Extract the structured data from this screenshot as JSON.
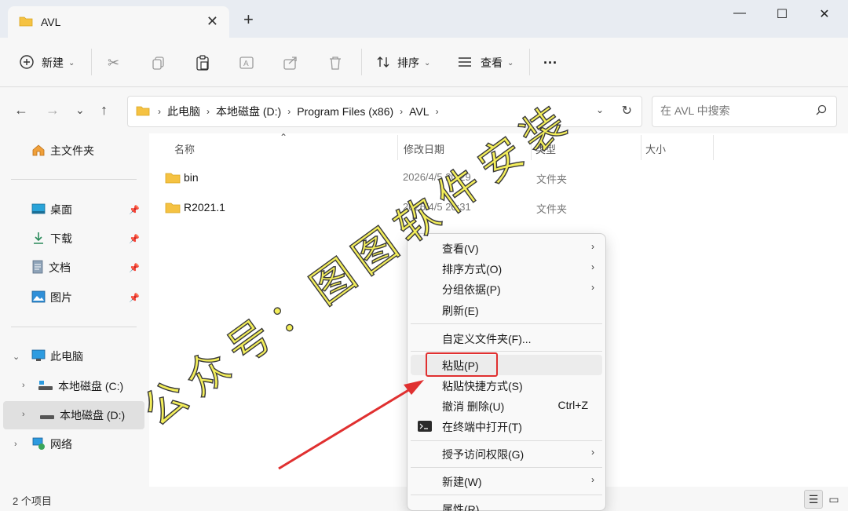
{
  "window": {
    "tab_title": "AVL",
    "tab_close": "✕",
    "new_tab": "+",
    "minimize": "—",
    "maximize": "☐",
    "close": "✕"
  },
  "toolbar": {
    "new_label": "新建",
    "sort_label": "排序",
    "view_label": "查看",
    "more_label": "···"
  },
  "address": {
    "crumbs": [
      "此电脑",
      "本地磁盘 (D:)",
      "Program Files (x86)",
      "AVL"
    ],
    "search_placeholder": "在 AVL 中搜索"
  },
  "sidebar": {
    "home": "主文件夹",
    "quick": [
      {
        "label": "桌面",
        "icon": "desktop-icon"
      },
      {
        "label": "下载",
        "icon": "download-icon"
      },
      {
        "label": "文档",
        "icon": "document-icon"
      },
      {
        "label": "图片",
        "icon": "pictures-icon"
      }
    ],
    "this_pc": "此电脑",
    "drives": [
      "本地磁盘 (C:)",
      "本地磁盘 (D:)"
    ],
    "network": "网络"
  },
  "columns": {
    "name": "名称",
    "date": "修改日期",
    "type": "类型",
    "size": "大小"
  },
  "files": [
    {
      "name": "bin",
      "date": "2026/4/5 20:29",
      "type": "文件夹"
    },
    {
      "name": "R2021.1",
      "date": "2026/4/5 20:31",
      "type": "文件夹"
    }
  ],
  "status": {
    "count": "2 个项目"
  },
  "context_menu": {
    "view": "查看(V)",
    "sort_by": "排序方式(O)",
    "group_by": "分组依据(P)",
    "refresh": "刷新(E)",
    "customize": "自定义文件夹(F)...",
    "paste": "粘贴(P)",
    "paste_shortcut": "粘贴快捷方式(S)",
    "undo_delete": "撤消 删除(U)",
    "undo_shortcut": "Ctrl+Z",
    "open_terminal": "在终端中打开(T)",
    "give_access": "授予访问权限(G)",
    "new": "新建(W)",
    "properties": "属性(R)"
  },
  "watermark": {
    "text": "公众号：图图软件安装"
  },
  "colors": {
    "folder": "#f5c242",
    "highlight_box": "#e03030",
    "arrow": "#e03030",
    "watermark_fill": "#f3ee5a"
  }
}
